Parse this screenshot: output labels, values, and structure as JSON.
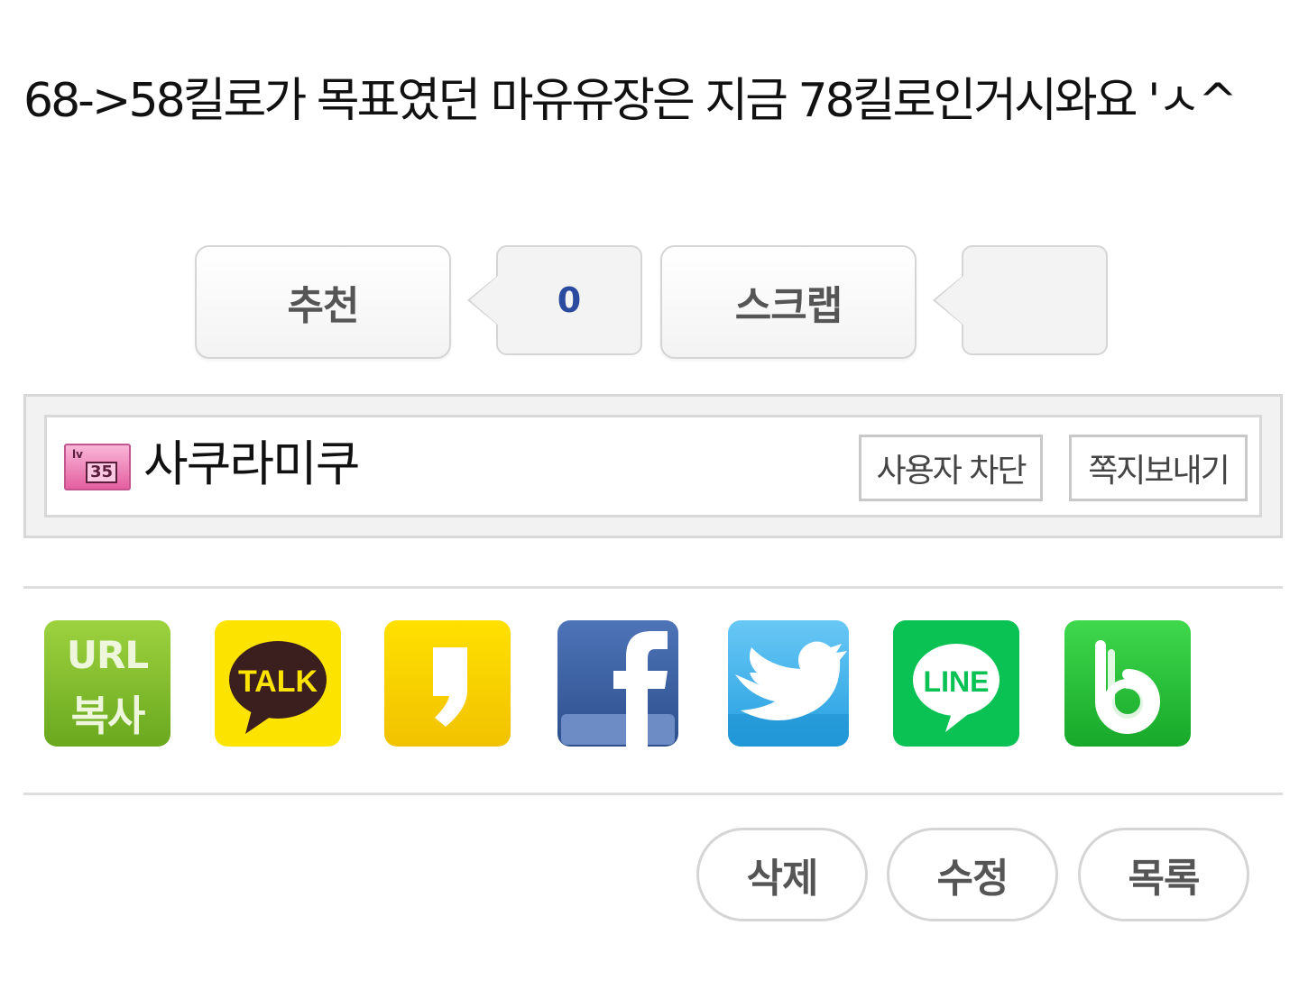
{
  "post": {
    "body_text": "68->58킬로가 목표였던 마유유장은 지금 78킬로인거시와요 'ㅅ^"
  },
  "vote": {
    "recommend_label": "추천",
    "recommend_count": "0",
    "scrap_label": "스크랩",
    "scrap_count": ""
  },
  "author": {
    "level_prefix": "lv",
    "level": "35",
    "name": "사쿠라미쿠",
    "block_label": "사용자 차단",
    "message_label": "쪽지보내기"
  },
  "share": {
    "items": [
      {
        "icon": "url-copy-icon",
        "line1": "URL",
        "line2": "복사"
      },
      {
        "icon": "kakaotalk-icon",
        "text": "TALK"
      },
      {
        "icon": "kakaostory-icon"
      },
      {
        "icon": "facebook-icon"
      },
      {
        "icon": "twitter-icon"
      },
      {
        "icon": "line-icon",
        "text": "LINE"
      },
      {
        "icon": "band-icon"
      }
    ]
  },
  "actions": {
    "delete_label": "삭제",
    "edit_label": "수정",
    "list_label": "목록"
  },
  "colors": {
    "count_blue": "#2a4aa0",
    "url_green": "#7fbf2a",
    "kakao_yellow": "#fde400",
    "facebook_blue": "#3b5998",
    "twitter_blue": "#3fb2ea",
    "line_green": "#09c253",
    "band_green": "#27c13a"
  }
}
